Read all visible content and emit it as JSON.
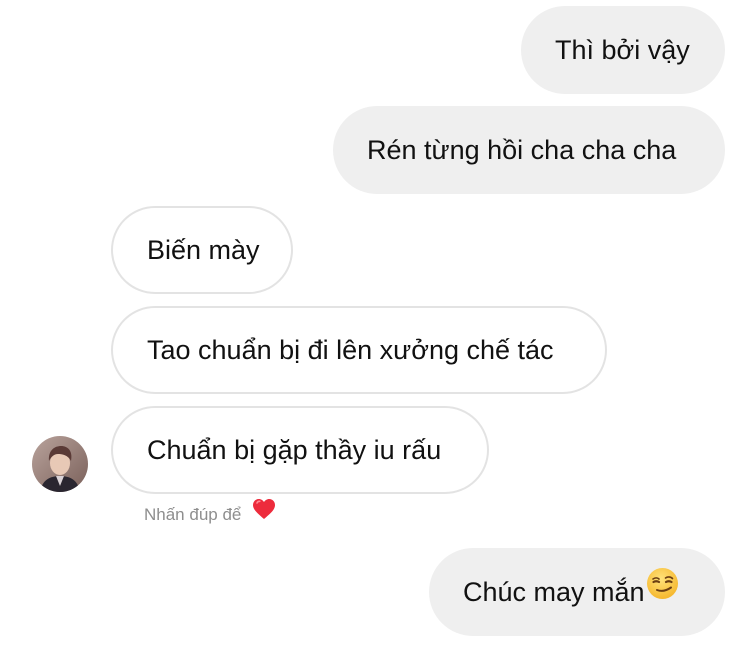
{
  "conversation": {
    "messages": [
      {
        "direction": "sent",
        "text": "Thì bởi vậy"
      },
      {
        "direction": "sent",
        "text": "Rén từng hồi cha cha cha"
      },
      {
        "direction": "received",
        "text": "Biến mày"
      },
      {
        "direction": "received",
        "text": "Tao chuẩn bị đi lên xưởng chế tác"
      },
      {
        "direction": "received",
        "text": "Chuẩn bị gặp thầy iu rấu"
      },
      {
        "direction": "sent",
        "text": "Chúc may mắn",
        "emoji": "smirking-face-icon"
      }
    ],
    "double_tap_hint": "Nhấn đúp để",
    "hint_icon": "heart-icon",
    "colors": {
      "sent_bubble": "#efefef",
      "received_border": "#e3e3e3",
      "hint_text": "#8e8e8e",
      "heart": "#ed2b3c"
    }
  }
}
